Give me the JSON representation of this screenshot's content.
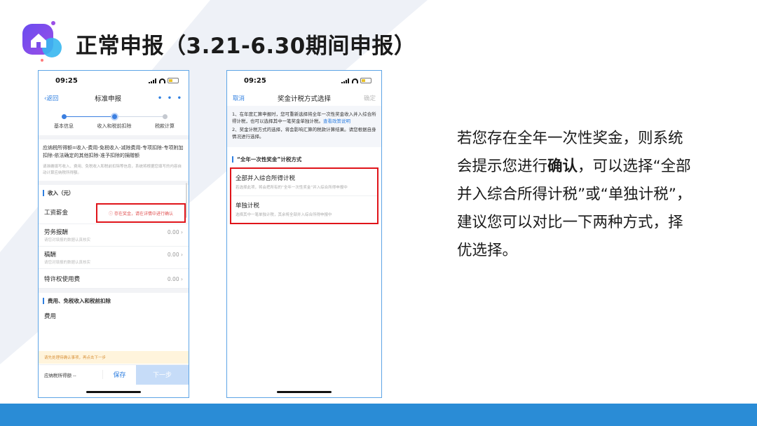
{
  "slide": {
    "title": "正常申报（3.21-6.30期间申报）",
    "body_text_parts": [
      "若您存在全年一次性奖金，则系统会提示您进行",
      "确认",
      "，可以选择“全部并入综合所得计税”或“单独计税”，建议您可以对比一下两种方式，择优选择。"
    ],
    "logo_icon": "house-icon",
    "accent_color": "#2a8cd6"
  },
  "phone1": {
    "status": {
      "time": "09:25"
    },
    "nav": {
      "back": "返回",
      "title": "标准申报",
      "more": "• • •"
    },
    "steps": [
      {
        "label": "基本信息",
        "state": "done"
      },
      {
        "label": "收入和税前扣除",
        "state": "current"
      },
      {
        "label": "税款计算",
        "state": "todo"
      }
    ],
    "formula": "应纳税所得额=收入-费用-免税收入-减除费用-专项扣除-专项附加扣除-依法确定的其他扣除-准予扣除的捐赠额",
    "formula_note": "请准确填写收入、费用、免税收入和税前扣除等信息，系统将根据您填写的内容自动计算应纳税所得额。",
    "income_section": "收入（元）",
    "rows": [
      {
        "label": "工资薪金",
        "value": "",
        "sub": ""
      },
      {
        "label": "劳务报酬",
        "value": "0.00",
        "sub": "请您对填报的数据认真核实"
      },
      {
        "label": "稿酬",
        "value": "0.00",
        "sub": "请您对填报的数据认真核实"
      },
      {
        "label": "特许权使用费",
        "value": "0.00",
        "sub": ""
      }
    ],
    "alert": "存在奖金，请在详情中进行确认",
    "deduction_section": "费用、免税收入和税前扣除",
    "fee_label": "费用",
    "warning": "请先处理待确认事项，再点击下一步",
    "bottom": {
      "label": "应纳税所得额 --",
      "save": "保存",
      "next": "下一步"
    }
  },
  "phone2": {
    "status": {
      "time": "09:25"
    },
    "nav": {
      "cancel": "取消",
      "title": "奖金计税方式选择",
      "confirm": "确定"
    },
    "info_1": "1、在年度汇算申报时，您可重新选择将全年一次性奖金收入并入综合所得计税，也可以选择其中一笔奖金单独计税。",
    "info_link": "查看政策说明",
    "info_2": "2、奖金计税方式的选择，将会影响汇算的税款计算结果。请您根据自身情况进行选择。",
    "section": "“全年一次性奖金”计税方式",
    "options": [
      {
        "title": "全部并入综合所得计税",
        "desc": "若选择此项，将会把所有的“全年一次性奖金”并入综合所得申报中"
      },
      {
        "title": "单独计税",
        "desc": "选择其中一笔单独计税，其余将全部并入综合所得申报中"
      }
    ]
  }
}
